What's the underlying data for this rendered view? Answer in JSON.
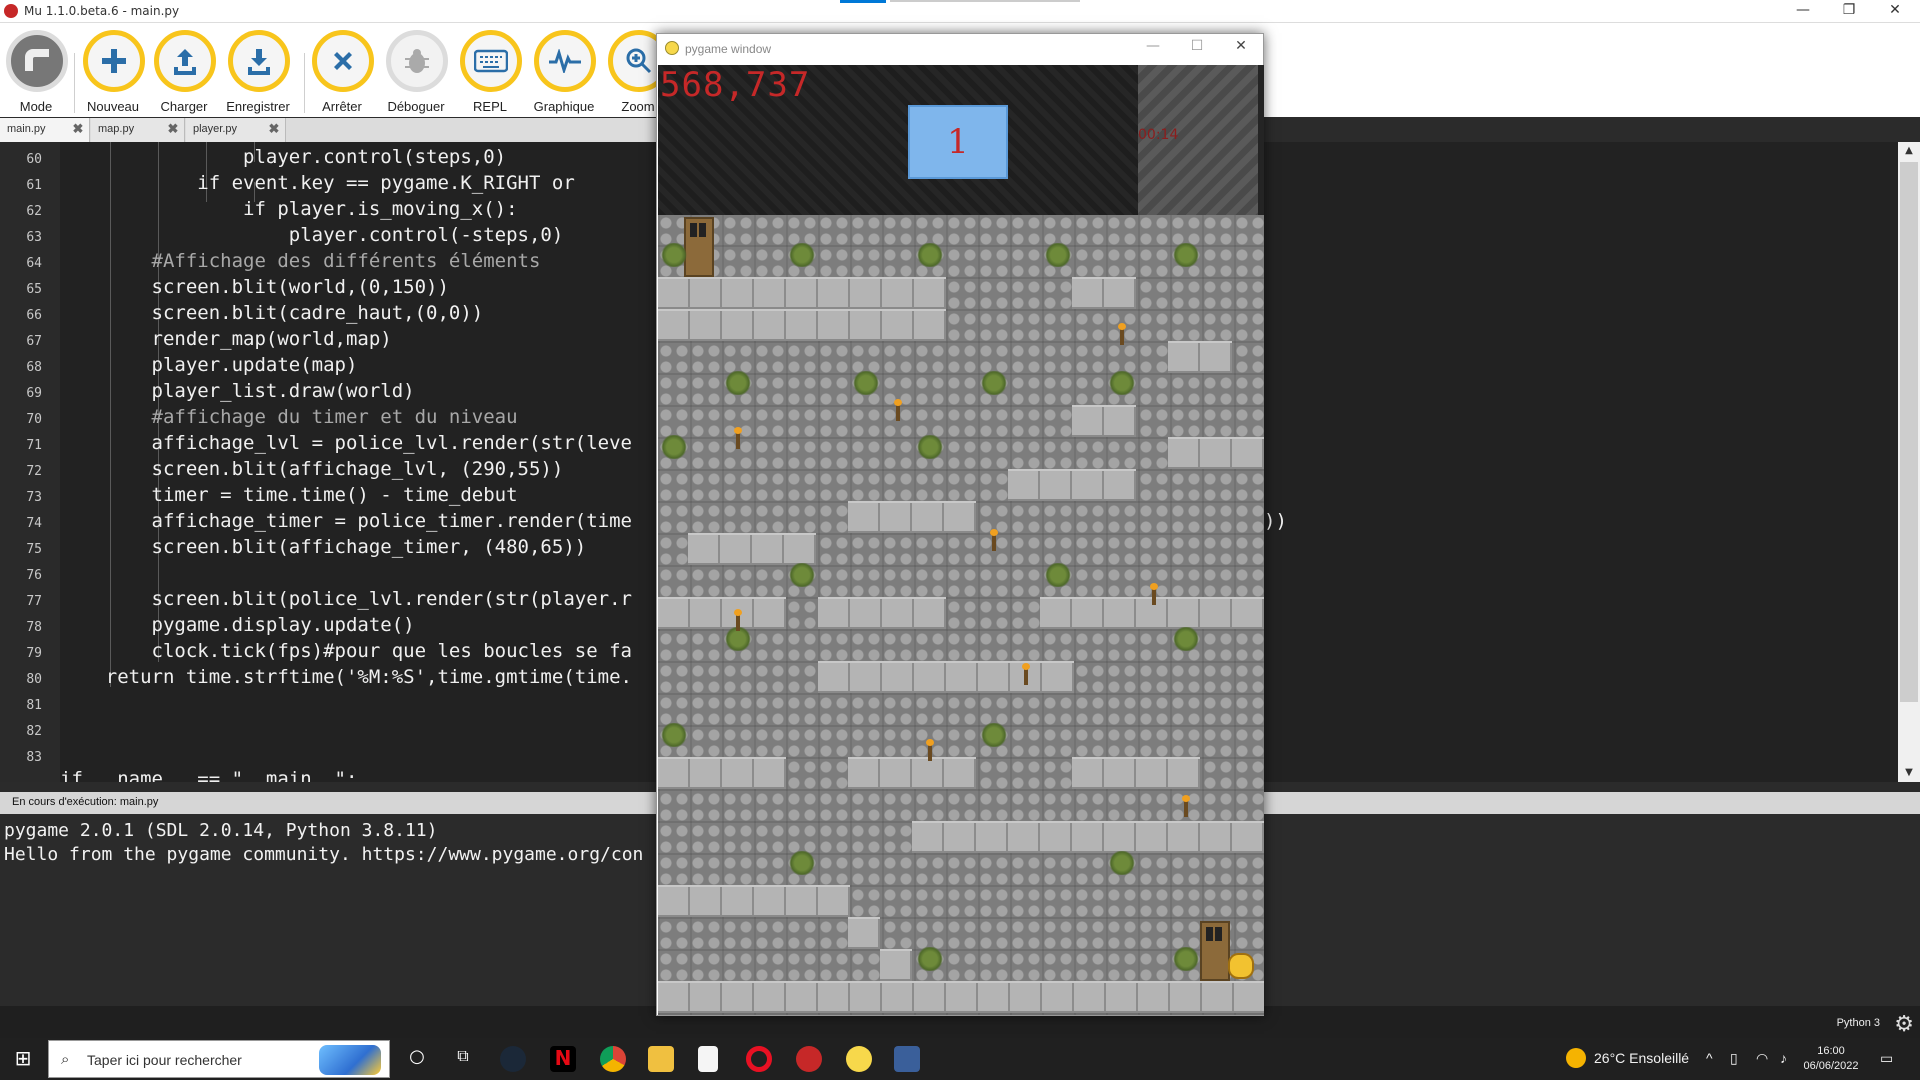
{
  "titlebar": {
    "title": "Mu 1.1.0.beta.6 - main.py",
    "minimize": "—",
    "maximize": "❐",
    "close": "✕"
  },
  "toolbar": {
    "mode": "Mode",
    "new": "Nouveau",
    "load": "Charger",
    "save": "Enregistrer",
    "stop": "Arrêter",
    "debug": "Déboguer",
    "repl": "REPL",
    "plotter": "Graphique",
    "zoom": "Zoom"
  },
  "tabs": [
    {
      "label": "main.py"
    },
    {
      "label": "map.py"
    },
    {
      "label": "player.py"
    }
  ],
  "editor": {
    "lines": [
      {
        "n": "60"
      },
      {
        "n": "61"
      },
      {
        "n": "62"
      },
      {
        "n": "63"
      },
      {
        "n": "64"
      },
      {
        "n": "65"
      },
      {
        "n": "66"
      },
      {
        "n": "67"
      },
      {
        "n": "68"
      },
      {
        "n": "69"
      },
      {
        "n": "70"
      },
      {
        "n": "71"
      },
      {
        "n": "72"
      },
      {
        "n": "73"
      },
      {
        "n": "74"
      },
      {
        "n": "75"
      },
      {
        "n": "76"
      },
      {
        "n": "77"
      },
      {
        "n": "78"
      },
      {
        "n": "79"
      },
      {
        "n": "80"
      },
      {
        "n": "81"
      },
      {
        "n": "82"
      },
      {
        "n": "83"
      }
    ],
    "code": {
      "l60": "                player.control(steps,0)",
      "l61": "            if event.key == pygame.K_RIGHT or",
      "l62": "                if player.is_moving_x():",
      "l63": "                    player.control(-steps,0)",
      "l64": "        #Affichage des différents éléments",
      "l65": "        screen.blit(world,(0,150))",
      "l66": "        screen.blit(cadre_haut,(0,0))",
      "l67": "        render_map(world,map)",
      "l68": "        player.update(map)",
      "l69": "        player_list.draw(world)",
      "l70": "        #affichage du timer et du niveau",
      "l71": "        affichage_lvl = police_lvl.render(str(leve",
      "l72": "        screen.blit(affichage_lvl, (290,55))",
      "l73": "        timer = time.time() - time_debut",
      "l74": "        affichage_timer = police_timer.render(time",
      "l75": "        screen.blit(affichage_timer, (480,65))",
      "l76": "",
      "l77": "        screen.blit(police_lvl.render(str(player.r",
      "l78": "        pygame.display.update()",
      "l79": "        clock.tick(fps)#pour que les boucles se fa",
      "l80": "    return time.strftime('%M:%S',time.gmtime(time.",
      "l81": "",
      "l82": "",
      "l83": "",
      "l84": "if __name__ == \"__main__\":",
      "overflow": "))"
    }
  },
  "runner": {
    "header": "En cours d'exécution: main.py",
    "output": [
      "pygame 2.0.1 (SDL 2.0.14, Python 3.8.11)",
      "Hello from the pygame community. https://www.pygame.org/con"
    ]
  },
  "status": {
    "mode": "Python 3"
  },
  "pygame": {
    "title": "pygame window",
    "timer": "568,737",
    "level": "1",
    "small_text": "00:14"
  },
  "taskbar": {
    "search_placeholder": "Taper ici pour rechercher",
    "weather": "26°C  Ensoleillé",
    "time": "16:00",
    "date": "06/06/2022"
  },
  "colors": {
    "accent_yellow": "#f8c51c",
    "timer_red": "#c62828",
    "editor_bg": "#222222"
  }
}
